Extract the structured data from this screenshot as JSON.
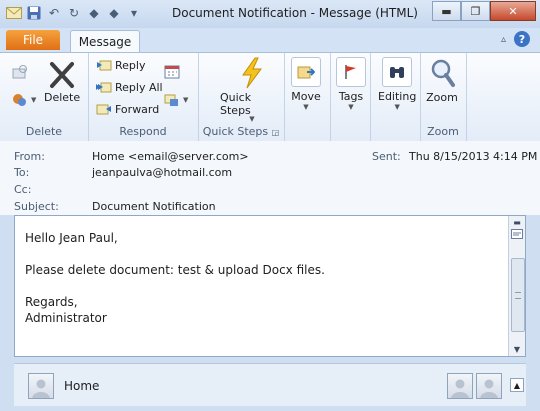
{
  "window": {
    "title": "Document Notification  -  Message (HTML)"
  },
  "qat": {
    "icons": [
      "email-icon",
      "save-icon",
      "undo-icon",
      "redo-icon",
      "up-icon",
      "down-icon",
      "customize-icon"
    ]
  },
  "tabs": {
    "file": "File",
    "message": "Message"
  },
  "ribbon": {
    "delete_group": {
      "label": "Delete",
      "delete": "Delete"
    },
    "respond_group": {
      "label": "Respond",
      "reply": "Reply",
      "reply_all": "Reply All",
      "forward": "Forward"
    },
    "quick_steps_group": {
      "label": "Quick Steps",
      "button": "Quick Steps"
    },
    "move": "Move",
    "tags": "Tags",
    "editing": "Editing",
    "zoom_group": {
      "label": "Zoom",
      "button": "Zoom"
    }
  },
  "message": {
    "from_label": "From:",
    "from_value": "Home <email@server.com>",
    "sent_label": "Sent:",
    "sent_value": "Thu 8/15/2013 4:14 PM",
    "to_label": "To:",
    "to_value": "jeanpaulva@hotmail.com",
    "cc_label": "Cc:",
    "subject_label": "Subject:",
    "subject_value": "Document Notification",
    "body": {
      "greeting": "Hello Jean Paul,",
      "line1": "Please delete document: test & upload Docx files.",
      "closing": "Regards,",
      "signature": "Administrator"
    }
  },
  "people_pane": {
    "name": "Home"
  },
  "colors": {
    "accent": "#e06f16",
    "ribbon": "#e3ecf8",
    "frame": "#cfdff1"
  }
}
